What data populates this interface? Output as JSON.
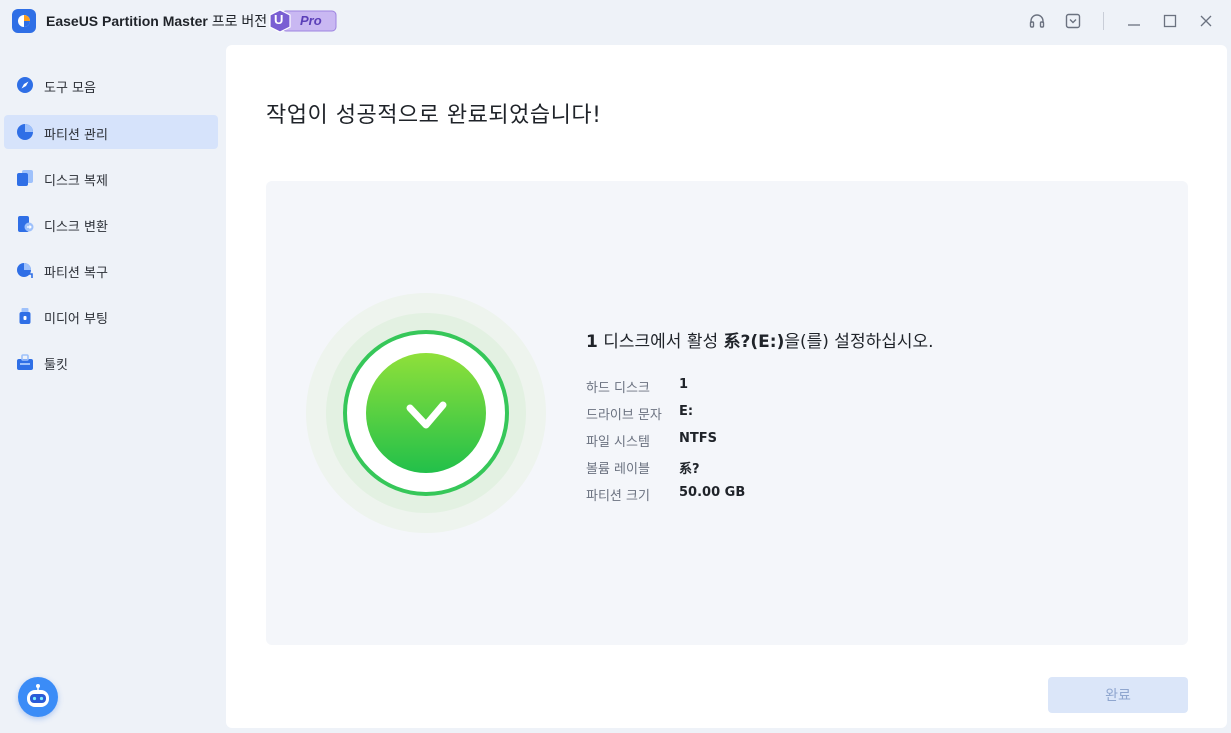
{
  "app": {
    "title": "EaseUS Partition Master",
    "title_suffix": "프로 버전",
    "badge_letter": "U",
    "badge_text": "Pro"
  },
  "window_controls": [
    "headset-icon",
    "dropdown-icon",
    "minimize-icon",
    "maximize-icon",
    "close-icon"
  ],
  "sidebar": {
    "items": [
      {
        "label": "도구 모음",
        "icon": "compass-icon",
        "active": false
      },
      {
        "label": "파티션 관리",
        "icon": "pie-chart-icon",
        "active": true
      },
      {
        "label": "디스크 복제",
        "icon": "copy-icon",
        "active": false
      },
      {
        "label": "디스크 변환",
        "icon": "convert-icon",
        "active": false
      },
      {
        "label": "파티션 복구",
        "icon": "recovery-icon",
        "active": false
      },
      {
        "label": "미디어 부팅",
        "icon": "usb-icon",
        "active": false
      },
      {
        "label": "툴킷",
        "icon": "toolkit-icon",
        "active": false
      }
    ]
  },
  "main": {
    "heading": "작업이 성공적으로 완료되었습니다!",
    "summary": {
      "disk_num": "1",
      "text": " 디스크에서 활성 ",
      "volume": "系?(E:)",
      "tail": "을(를) 설정하십시오."
    },
    "details": [
      {
        "key": "하드 디스크",
        "value": "1"
      },
      {
        "key": "드라이브 문자",
        "value": "E:"
      },
      {
        "key": "파일 시스템",
        "value": "NTFS"
      },
      {
        "key": "볼륨 레이블",
        "value": "系?"
      },
      {
        "key": "파티션 크기",
        "value": "50.00 GB"
      }
    ],
    "done_label": "완료"
  },
  "colors": {
    "accent": "#2f6fe6",
    "success_green": "#34c759",
    "active_nav_bg": "#d6e3fb"
  }
}
